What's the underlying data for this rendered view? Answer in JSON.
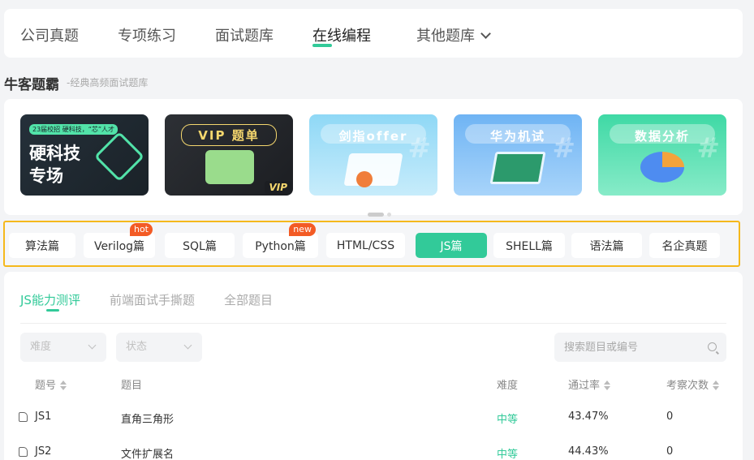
{
  "topnav": {
    "items": [
      "公司真题",
      "专项练习",
      "面试题库",
      "在线编程",
      "其他题库"
    ],
    "active_index": 3
  },
  "section": {
    "title": "牛客题霸",
    "subtitle": "-经典高频面试题库"
  },
  "banners": [
    {
      "pill": "23届校招 硬科技，“芯”人才",
      "title": "硬科技专场",
      "title_line1": "硬科技",
      "title_line2": "专场"
    },
    {
      "title": "VIP 题单",
      "badge": "VIP"
    },
    {
      "title": "剑指offer"
    },
    {
      "title": "华为机试"
    },
    {
      "title": "数据分析"
    }
  ],
  "tags": [
    {
      "label": "算法篇"
    },
    {
      "label": "Verilog篇",
      "badge": "hot"
    },
    {
      "label": "SQL篇"
    },
    {
      "label": "Python篇",
      "badge": "new"
    },
    {
      "label": "HTML/CSS"
    },
    {
      "label": "JS篇",
      "active": true
    },
    {
      "label": "SHELL篇"
    },
    {
      "label": "语法篇"
    },
    {
      "label": "名企真题"
    }
  ],
  "subtabs": [
    "JS能力测评",
    "前端面试手撕题",
    "全部题目"
  ],
  "filters": {
    "difficulty": "难度",
    "status": "状态"
  },
  "search": {
    "placeholder": "搜索题目或编号"
  },
  "table": {
    "headers": {
      "id": "题号",
      "title": "题目",
      "difficulty": "难度",
      "pass_rate": "通过率",
      "count": "考察次数"
    },
    "rows": [
      {
        "id": "JS1",
        "title": "直角三角形",
        "difficulty": "中等",
        "pass_rate": "43.47%",
        "count": "0"
      },
      {
        "id": "JS2",
        "title": "文件扩展名",
        "difficulty": "中等",
        "pass_rate": "44.43%",
        "count": "0"
      }
    ]
  },
  "colors": {
    "accent": "#32ca99",
    "highlight_border": "#f5b81c",
    "badge": "#f35b25"
  }
}
